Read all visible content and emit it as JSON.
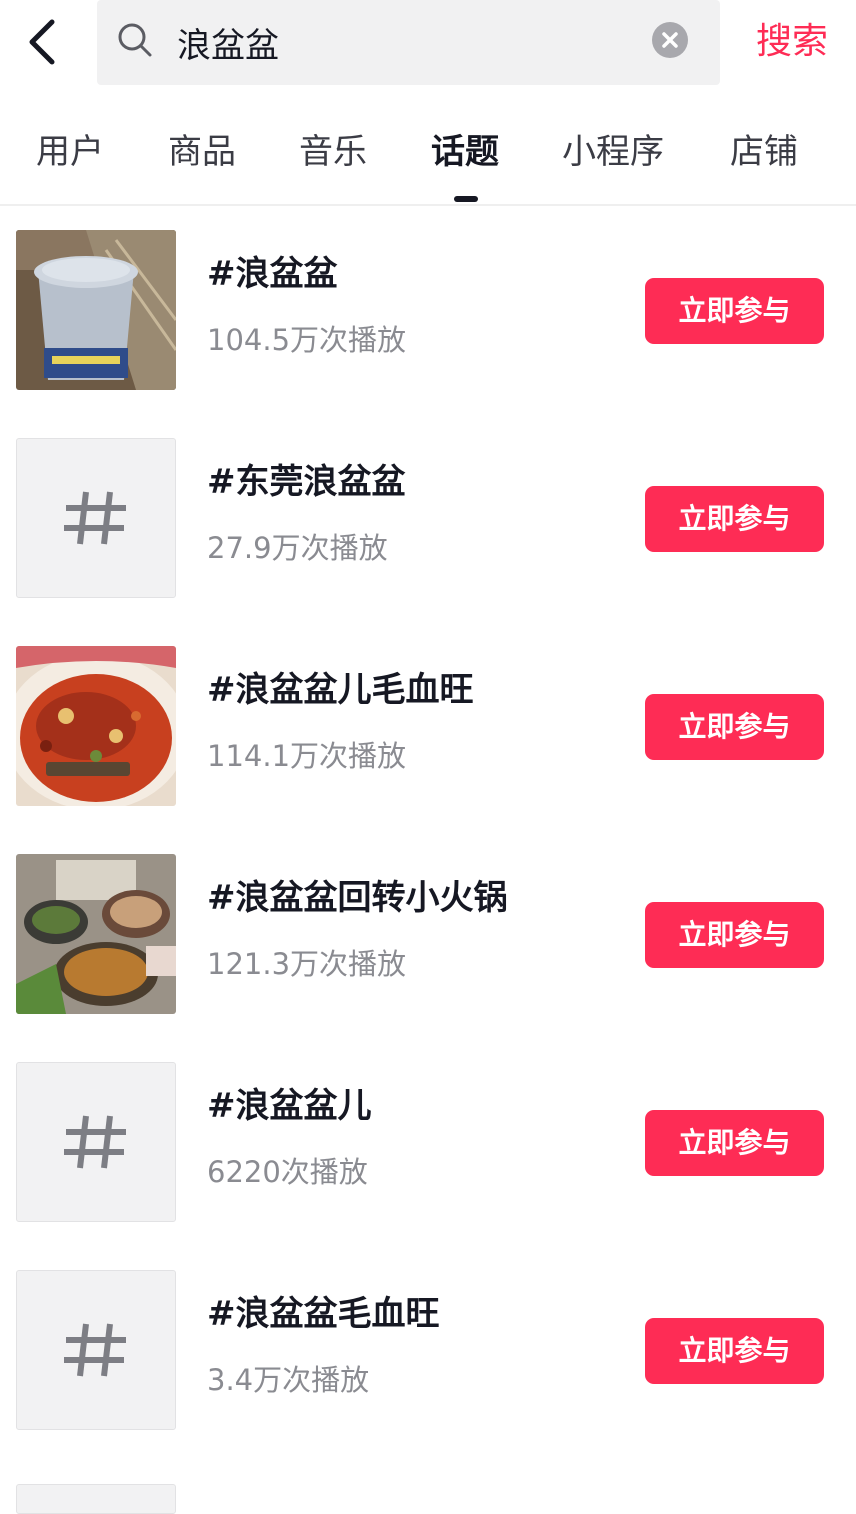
{
  "header": {
    "search_value": "浪盆盆",
    "search_button_label": "搜索"
  },
  "tabs": [
    {
      "label": "用户",
      "active": false
    },
    {
      "label": "商品",
      "active": false
    },
    {
      "label": "音乐",
      "active": false
    },
    {
      "label": "话题",
      "active": true
    },
    {
      "label": "小程序",
      "active": false
    },
    {
      "label": "店铺",
      "active": false
    }
  ],
  "topics": [
    {
      "title": "#浪盆盆",
      "plays": "104.5万次播放",
      "button": "立即参与",
      "thumb": "cup-photo"
    },
    {
      "title": "#东莞浪盆盆",
      "plays": "27.9万次播放",
      "button": "立即参与",
      "thumb": "hashtag-icon"
    },
    {
      "title": "#浪盆盆儿毛血旺",
      "plays": "114.1万次播放",
      "button": "立即参与",
      "thumb": "spicy-dish-photo"
    },
    {
      "title": "#浪盆盆回转小火锅",
      "plays": "121.3万次播放",
      "button": "立即参与",
      "thumb": "hotpot-photo"
    },
    {
      "title": "#浪盆盆儿",
      "plays": "6220次播放",
      "button": "立即参与",
      "thumb": "hashtag-icon"
    },
    {
      "title": "#浪盆盆毛血旺",
      "plays": "3.4万次播放",
      "button": "立即参与",
      "thumb": "hashtag-icon"
    }
  ],
  "colors": {
    "accent": "#fe2c55",
    "text_primary": "#161823",
    "text_secondary": "#8a8b91",
    "search_bg": "#f1f1f2"
  }
}
